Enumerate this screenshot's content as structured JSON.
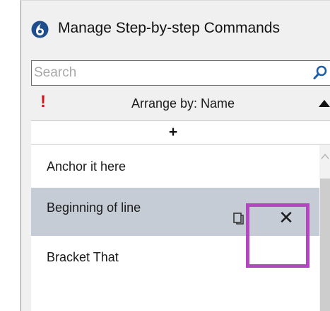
{
  "window": {
    "title": "Manage Step-by-step Commands",
    "icon": "app-logo-icon"
  },
  "search": {
    "placeholder": "Search",
    "value": "",
    "icon": "search-icon"
  },
  "arrange": {
    "priority_mark": "!",
    "label": "Arrange by: Name",
    "sort_direction": "ascending"
  },
  "add_button": {
    "label": "+"
  },
  "commands": [
    {
      "label": "Anchor it here",
      "selected": false
    },
    {
      "label": "Beginning of line",
      "selected": true
    },
    {
      "label": "Bracket That",
      "selected": false
    }
  ],
  "row_actions": {
    "duplicate_icon": "duplicate-icon",
    "delete_label": "✕"
  },
  "colors": {
    "selected_row": "#c5ccd6",
    "highlight_box": "#b446c2",
    "priority": "#d6141e",
    "search_icon": "#1f5fa8",
    "app_icon": "#1f4e8c"
  }
}
